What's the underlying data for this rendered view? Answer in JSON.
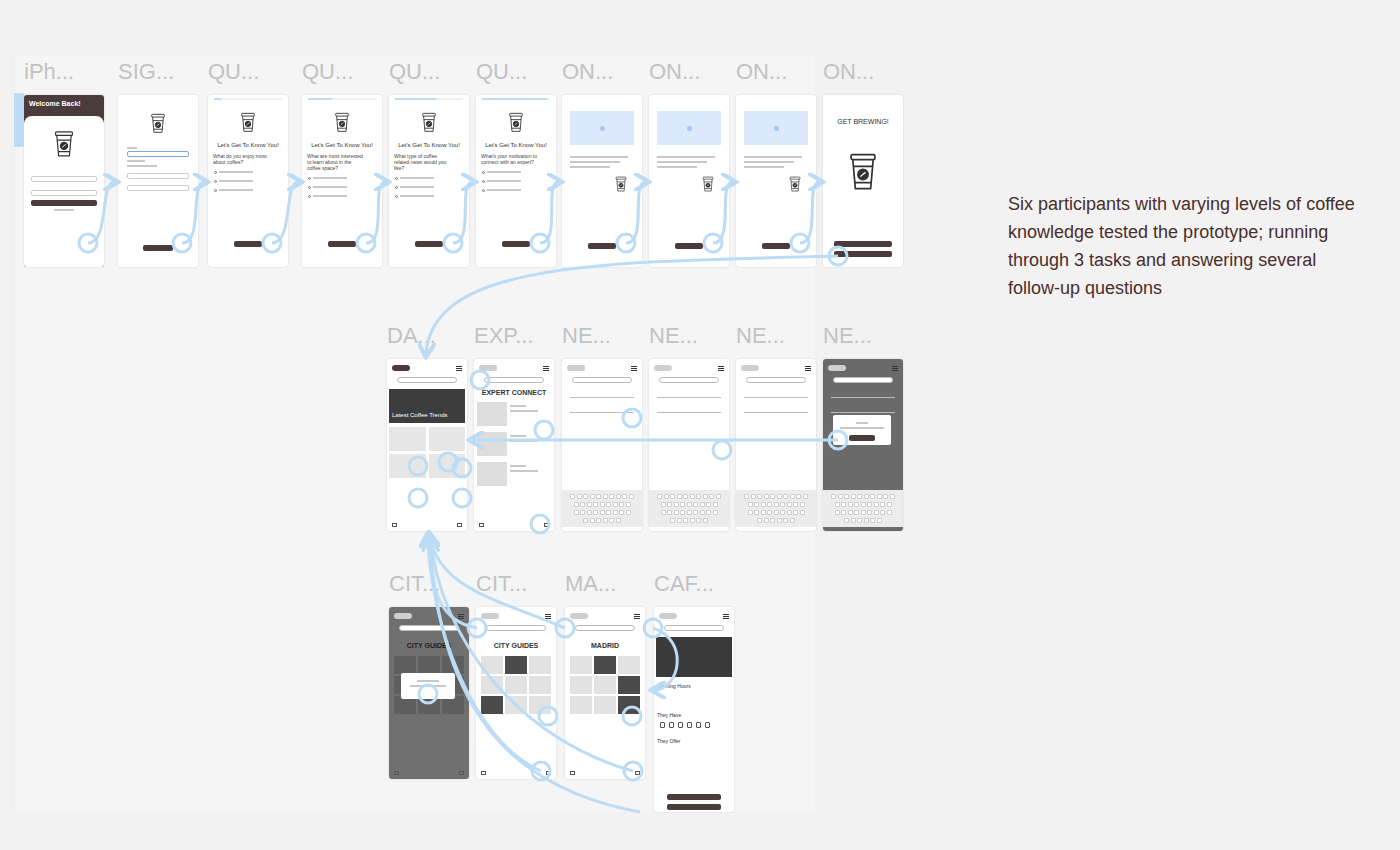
{
  "note": "Six participants with varying levels of coffee knowledge tested the prototype; running through 3 tasks and answering several follow-up questions",
  "rows": [
    {
      "frames": [
        {
          "label": "iPh...",
          "kind": "login",
          "title": "Welcome Back!",
          "start": true
        },
        {
          "label": "SIG...",
          "kind": "signup",
          "start": false
        },
        {
          "label": "QU...",
          "kind": "question",
          "level": 0.1,
          "title": "Let's Get To Know You!",
          "question": "What do you enjoy most about coffee?",
          "start": false
        },
        {
          "label": "QU...",
          "kind": "question",
          "level": 0.35,
          "title": "Let's Get To Know You!",
          "question": "What are most interested to learn about in the coffee space?",
          "start": false
        },
        {
          "label": "QU...",
          "kind": "question",
          "level": 0.6,
          "title": "Let's Get To Know You!",
          "question": "What type of coffee related news would you like?",
          "start": false
        },
        {
          "label": "QU...",
          "kind": "question",
          "level": 0.95,
          "title": "Let's Get To Know You!",
          "question": "What's your motivation to connect with an expert?",
          "start": false
        },
        {
          "label": "ON...",
          "kind": "onboarding",
          "start": false
        },
        {
          "label": "ON...",
          "kind": "onboarding",
          "start": false
        },
        {
          "label": "ON...",
          "kind": "onboarding",
          "start": false
        },
        {
          "label": "ON...",
          "kind": "final",
          "title": "GET BREWING!",
          "start": false
        }
      ]
    },
    {
      "frames": [
        {
          "label": "DA...",
          "kind": "dashboard",
          "title": "Latest Coffee Trends",
          "start": false
        },
        {
          "label": "EXP...",
          "kind": "expert",
          "title": "EXPERT CONNECT",
          "start": false
        },
        {
          "label": "NE...",
          "kind": "news",
          "start": false
        },
        {
          "label": "NE...",
          "kind": "news",
          "start": false
        },
        {
          "label": "NE...",
          "kind": "news",
          "start": false
        },
        {
          "label": "NE...",
          "kind": "news-modal",
          "start": false
        }
      ]
    },
    {
      "frames": [
        {
          "label": "CIT...",
          "kind": "city-modal",
          "title": "CITY GUIDES",
          "start": false
        },
        {
          "label": "CIT...",
          "kind": "city",
          "title": "CITY GUIDES",
          "start": false
        },
        {
          "label": "MA...",
          "kind": "map",
          "title": "MADRID",
          "start": false
        },
        {
          "label": "CAF...",
          "kind": "cafe",
          "opening": "Opening Hours",
          "have": "They Have",
          "offer": "They Offer",
          "start": false
        }
      ]
    }
  ]
}
